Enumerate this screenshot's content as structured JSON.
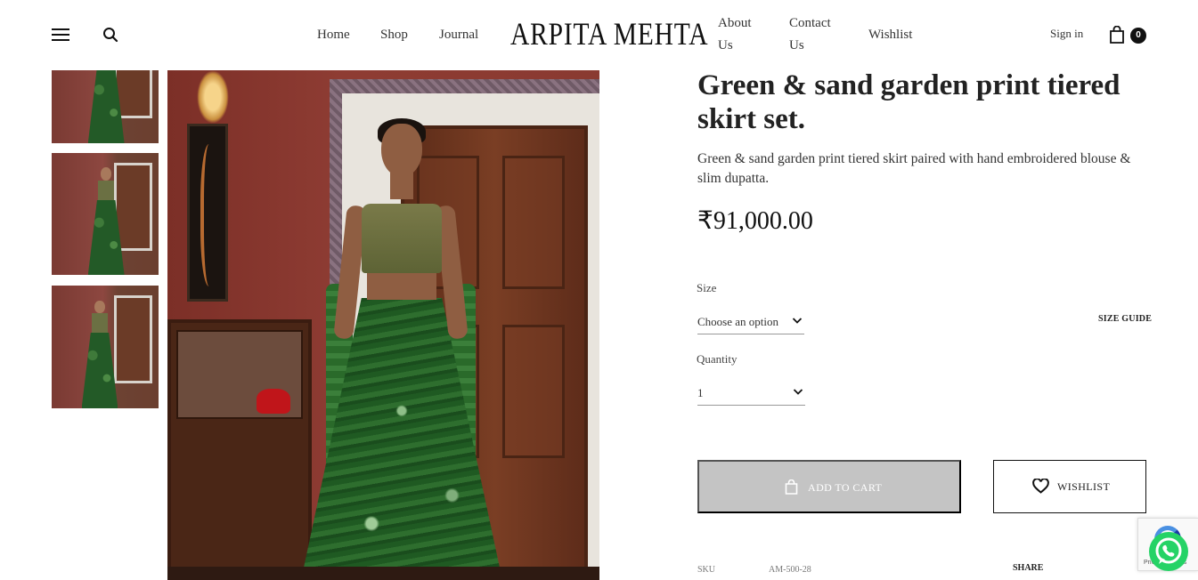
{
  "header": {
    "nav_left": [
      "Home",
      "Shop",
      "Journal"
    ],
    "logo": "ARPITA MEHTA",
    "nav_right": {
      "about_line1": "About",
      "about_line2": "Us",
      "contact_line1": "Contact",
      "contact_line2": "Us",
      "wishlist": "Wishlist"
    },
    "sign_in": "Sign in",
    "cart_count": "0"
  },
  "product": {
    "title": "Green & sand garden print tiered skirt set.",
    "description": "Green & sand garden print tiered skirt paired with hand embroidered blouse & slim dupatta.",
    "price": "₹91,000.00",
    "size": {
      "label": "Size",
      "selected": "Choose an option",
      "size_guide": "SIZE GUIDE"
    },
    "quantity": {
      "label": "Quantity",
      "selected": "1"
    },
    "add_to_cart": "ADD TO CART",
    "wishlist_button": "WISHLIST",
    "sku_label": "SKU",
    "sku_value": "AM-500-28",
    "share": "SHARE"
  },
  "recaptcha_text": "Privacy - Terms",
  "icons": {
    "menu": "hamburger-icon",
    "search": "search-icon",
    "cart": "shopping-bag-icon",
    "wishlist": "heart-icon",
    "add_to_cart": "bag-icon",
    "whatsapp": "whatsapp-icon",
    "select": "chevron-down-icon"
  },
  "colors": {
    "accent": "#111111",
    "disabled_button": "#c4c4c4",
    "whatsapp": "#25d366"
  }
}
